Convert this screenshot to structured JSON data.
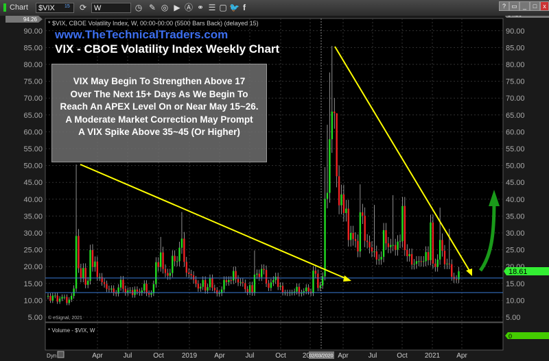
{
  "toolbar": {
    "app_label": "Chart",
    "symbol": "$VIX",
    "symbol_badge": "15",
    "interval": "W",
    "window_buttons": [
      "?",
      "▭",
      "_",
      "□",
      "x"
    ]
  },
  "chart_header": "* $VIX, CBOE Volatility Index, W, 00:00-00:00 (5500 Bars Back) (delayed 15)",
  "watermark": "www.TheTechnicalTraders.com",
  "title": "VIX - CBOE Volatility Index Weekly Chart",
  "annotation_lines": [
    "VIX May Begin To Strengthen Above 17",
    "Over The Next 15+ Days As We Begin To",
    "Reach An APEX Level On or Near May 15~26.",
    "A Moderate Market Correction May Prompt",
    "A VIX Spike Above 35~45 (Or Higher)"
  ],
  "copyright": "© eSignal, 2021",
  "volume_label": "* Volume - $VIX, W",
  "volume_value": "0",
  "dyn_label": "Dyn",
  "colors": {
    "up": "#22dd22",
    "down": "#ee2222",
    "trendline": "#ffff00",
    "support": "#3a7bd5",
    "arrow": "#1a9a1a",
    "last_price": "#33ee33"
  },
  "chart_data": {
    "type": "candlestick",
    "ylim": [
      5,
      94.26
    ],
    "y_ticks": [
      "90.00",
      "85.00",
      "80.00",
      "75.00",
      "70.00",
      "65.00",
      "60.00",
      "55.00",
      "50.00",
      "45.00",
      "40.00",
      "35.00",
      "30.00",
      "25.00",
      "20.00",
      "15.00",
      "10.00",
      "5.00"
    ],
    "y_max_tag": "94.26",
    "last_price": "18.61",
    "x_ticks": [
      "Apr",
      "Jul",
      "Oct",
      "2019",
      "Apr",
      "Jul",
      "Oct",
      "2020",
      "Apr",
      "Jul",
      "Oct",
      "2021",
      "Apr"
    ],
    "crosshair_date": "02/03/2020",
    "weekly_close": [
      11.3,
      9.9,
      11.4,
      11.4,
      9.6,
      10.5,
      11.0,
      11.0,
      9.2,
      10.2,
      11.3,
      13.5,
      29.1,
      19.5,
      16.5,
      19.6,
      14.6,
      15.8,
      24.9,
      19.9,
      21.5,
      16.9,
      16.9,
      15.4,
      14.8,
      13.4,
      13.2,
      13.5,
      12.2,
      12.0,
      13.8,
      16.1,
      13.4,
      12.2,
      12.9,
      13.0,
      11.6,
      13.2,
      12.6,
      12.2,
      12.9,
      14.9,
      12.1,
      11.7,
      12.1,
      14.8,
      21.3,
      19.9,
      24.2,
      19.3,
      18.1,
      17.3,
      18.1,
      23.2,
      21.6,
      21.6,
      25.6,
      28.3,
      21.4,
      18.2,
      17.8,
      17.4,
      16.1,
      14.9,
      13.5,
      14.0,
      16.0,
      12.9,
      13.9,
      16.5,
      13.7,
      13.0,
      12.0,
      12.1,
      13.2,
      16.0,
      15.4,
      16.0,
      15.9,
      18.7,
      16.3,
      15.3,
      15.4,
      15.1,
      13.3,
      12.4,
      14.5,
      12.2,
      17.6,
      17.9,
      16.9,
      19.3,
      19.0,
      15.0,
      13.7,
      15.3,
      16.0,
      17.0,
      14.0,
      14.3,
      12.3,
      12.3,
      12.1,
      12.3,
      12.3,
      12.6,
      14.0,
      12.0,
      12.3,
      12.7,
      13.8,
      12.6,
      12.1,
      18.8,
      17.9,
      13.7,
      14.4,
      17.1,
      40.1,
      41.9,
      57.8,
      66.0,
      65.5,
      46.8,
      38.2,
      41.4,
      35.9,
      37.2,
      27.9,
      30.0,
      28.2,
      27.6,
      24.5,
      36.1,
      35.1,
      27.7,
      27.3,
      25.7,
      24.5,
      24.5,
      22.1,
      22.1,
      22.9,
      30.8,
      26.9,
      25.8,
      26.4,
      26.4,
      25.0,
      27.4,
      27.6,
      38.0,
      24.9,
      23.1,
      23.7,
      20.6,
      20.8,
      21.6,
      21.6,
      21.5,
      21.6,
      24.3,
      21.9,
      33.1,
      20.9,
      19.9,
      22.1,
      27.9,
      24.7,
      20.7,
      20.9,
      20.7,
      17.0,
      16.3,
      16.2,
      18.6
    ],
    "weekly_high_overrides": {
      "12": 50.3,
      "18": 26.5,
      "48": 28.8,
      "57": 36.2,
      "88": 24.8,
      "118": 49.5,
      "119": 62.1,
      "120": 77.6,
      "121": 85.5,
      "122": 70.0,
      "123": 60.6,
      "133": 44.4,
      "139": 38.3,
      "147": 41.2,
      "167": 37.5,
      "171": 31.2
    },
    "support_levels": [
      16.6,
      12.3
    ]
  }
}
